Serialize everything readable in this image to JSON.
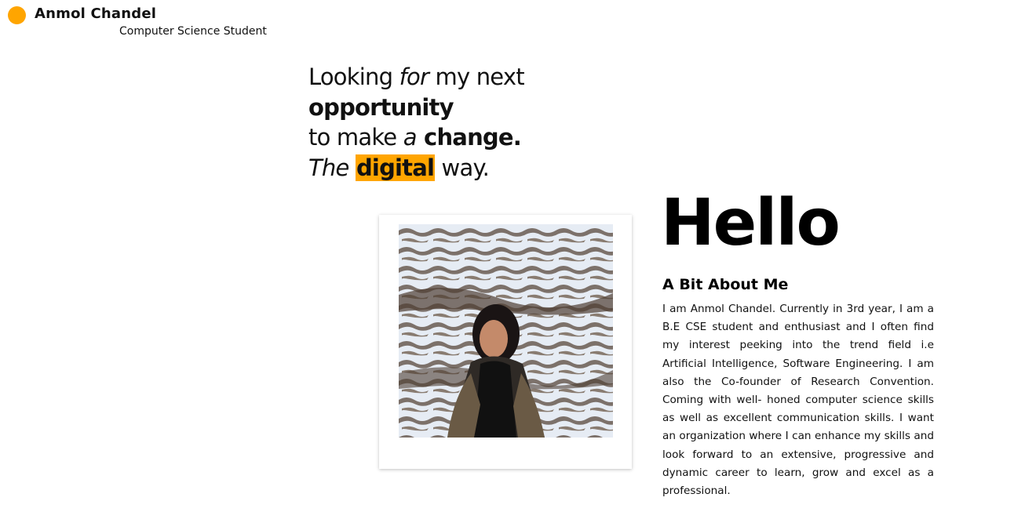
{
  "header": {
    "name": "Anmol Chandel",
    "subtitle": "Computer Science Student",
    "logo_color": "#FFA500"
  },
  "hero": {
    "line1": [
      "Looking ",
      "for",
      " my next"
    ],
    "line2": "opportunity",
    "line3": [
      "to make ",
      "a",
      " change."
    ],
    "line4": [
      "The",
      "digital",
      " way."
    ],
    "highlight_color": "#FFA500"
  },
  "photo": {
    "description_icon": "profile-photo"
  },
  "about": {
    "greeting": "Hello",
    "heading": "A Bit About Me",
    "body": "I am Anmol Chandel. Currently in 3rd year, I am a B.E CSE student and enthusiast and I often find my interest peeking into the trend field i.e Artificial Intelligence, Software Engineering. I am also the Co-founder of Research Convention. Coming with well- honed computer science skills as well as excellent communication skills. I want an organization where I can enhance my skills and look forward to an extensive, progressive and dynamic career to learn, grow and excel as a professional."
  }
}
